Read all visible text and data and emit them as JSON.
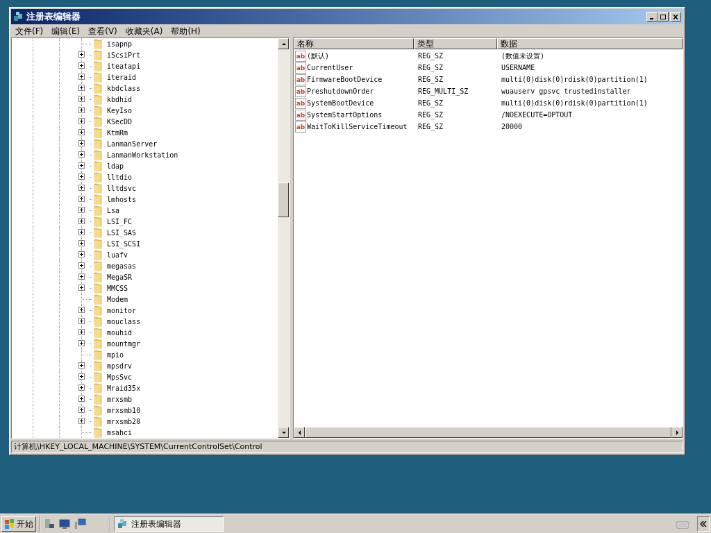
{
  "window": {
    "title": "注册表编辑器"
  },
  "menu": [
    "文件(F)",
    "编辑(E)",
    "查看(V)",
    "收藏夹(A)",
    "帮助(H)"
  ],
  "tree": [
    {
      "label": "isapnp",
      "expandable": false
    },
    {
      "label": "iScsiPrt",
      "expandable": true
    },
    {
      "label": "iteatapi",
      "expandable": true
    },
    {
      "label": "iteraid",
      "expandable": true
    },
    {
      "label": "kbdclass",
      "expandable": true
    },
    {
      "label": "kbdhid",
      "expandable": true
    },
    {
      "label": "KeyIso",
      "expandable": true
    },
    {
      "label": "KSecDD",
      "expandable": true
    },
    {
      "label": "KtmRm",
      "expandable": true
    },
    {
      "label": "LanmanServer",
      "expandable": true
    },
    {
      "label": "LanmanWorkstation",
      "expandable": true
    },
    {
      "label": "ldap",
      "expandable": true
    },
    {
      "label": "lltdio",
      "expandable": true
    },
    {
      "label": "lltdsvc",
      "expandable": true
    },
    {
      "label": "lmhosts",
      "expandable": true
    },
    {
      "label": "Lsa",
      "expandable": true
    },
    {
      "label": "LSI_FC",
      "expandable": true
    },
    {
      "label": "LSI_SAS",
      "expandable": true
    },
    {
      "label": "LSI_SCSI",
      "expandable": true
    },
    {
      "label": "luafv",
      "expandable": true
    },
    {
      "label": "megasas",
      "expandable": true
    },
    {
      "label": "MegaSR",
      "expandable": true
    },
    {
      "label": "MMCSS",
      "expandable": true
    },
    {
      "label": "Modem",
      "expandable": false
    },
    {
      "label": "monitor",
      "expandable": true
    },
    {
      "label": "mouclass",
      "expandable": true
    },
    {
      "label": "mouhid",
      "expandable": true
    },
    {
      "label": "mountmgr",
      "expandable": true
    },
    {
      "label": "mpio",
      "expandable": false
    },
    {
      "label": "mpsdrv",
      "expandable": true
    },
    {
      "label": "MpsSvc",
      "expandable": true
    },
    {
      "label": "Mraid35x",
      "expandable": true
    },
    {
      "label": "mrxsmb",
      "expandable": true
    },
    {
      "label": "mrxsmb10",
      "expandable": true
    },
    {
      "label": "mrxsmb20",
      "expandable": true
    },
    {
      "label": "msahci",
      "expandable": false
    }
  ],
  "values": {
    "columns": [
      "名称",
      "类型",
      "数据"
    ],
    "rows": [
      {
        "icon": "ab",
        "name": "(默认)",
        "type": "REG_SZ",
        "data": "(数值未设置)"
      },
      {
        "icon": "ab",
        "name": "CurrentUser",
        "type": "REG_SZ",
        "data": "USERNAME"
      },
      {
        "icon": "ab",
        "name": "FirmwareBootDevice",
        "type": "REG_SZ",
        "data": "multi(0)disk(0)rdisk(0)partition(1)"
      },
      {
        "icon": "ab",
        "name": "PreshutdownOrder",
        "type": "REG_MULTI_SZ",
        "data": "wuauserv gpsvc trustedinstaller"
      },
      {
        "icon": "ab",
        "name": "SystemBootDevice",
        "type": "REG_SZ",
        "data": "multi(0)disk(0)rdisk(0)partition(1)"
      },
      {
        "icon": "ab",
        "name": "SystemStartOptions",
        "type": "REG_SZ",
        "data": "/NOEXECUTE=OPTOUT"
      },
      {
        "icon": "ab",
        "name": "WaitToKillServiceTimeout",
        "type": "REG_SZ",
        "data": "20000"
      }
    ]
  },
  "status_bar": "计算机\\HKEY_LOCAL_MACHINE\\SYSTEM\\CurrentControlSet\\Control",
  "taskbar": {
    "start": "开始",
    "task": "注册表编辑器"
  }
}
